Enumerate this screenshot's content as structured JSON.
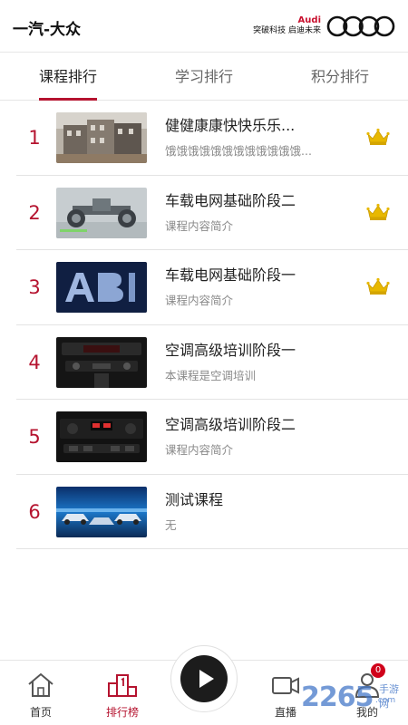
{
  "header": {
    "brand": "一汽-大众",
    "audi_word": "Audi",
    "audi_slogan": "突破科技 启迪未来"
  },
  "tabs": [
    {
      "label": "课程排行",
      "active": true
    },
    {
      "label": "学习排行",
      "active": false
    },
    {
      "label": "积分排行",
      "active": false
    }
  ],
  "courses": [
    {
      "rank": "1",
      "title": "健健康康快快乐乐...",
      "desc": "饿饿饿饿饿饿饿饿饿饿饿饿...",
      "crown": true,
      "thumb": "buildings"
    },
    {
      "rank": "2",
      "title": "车载电网基础阶段二",
      "desc": "课程内容简介",
      "crown": true,
      "thumb": "chassis"
    },
    {
      "rank": "3",
      "title": "车载电网基础阶段一",
      "desc": "课程内容简介",
      "crown": true,
      "thumb": "a8-logo"
    },
    {
      "rank": "4",
      "title": "空调高级培训阶段一",
      "desc": "本课程是空调培训",
      "crown": false,
      "thumb": "climate-panel"
    },
    {
      "rank": "5",
      "title": "空调高级培训阶段二",
      "desc": "课程内容简介",
      "crown": false,
      "thumb": "climate-panel-2"
    },
    {
      "rank": "6",
      "title": "测试课程",
      "desc": "无",
      "crown": false,
      "thumb": "blue-cars"
    }
  ],
  "bottom_nav": {
    "home": "首页",
    "ranking": "排行榜",
    "live": "直播",
    "mine": "我的",
    "badge_count": "0"
  },
  "watermark": {
    "main": "2265",
    "sub1": "手游网",
    "sub2": ".com"
  },
  "colors": {
    "accent": "#b5132f",
    "crown": "#e8b800"
  }
}
